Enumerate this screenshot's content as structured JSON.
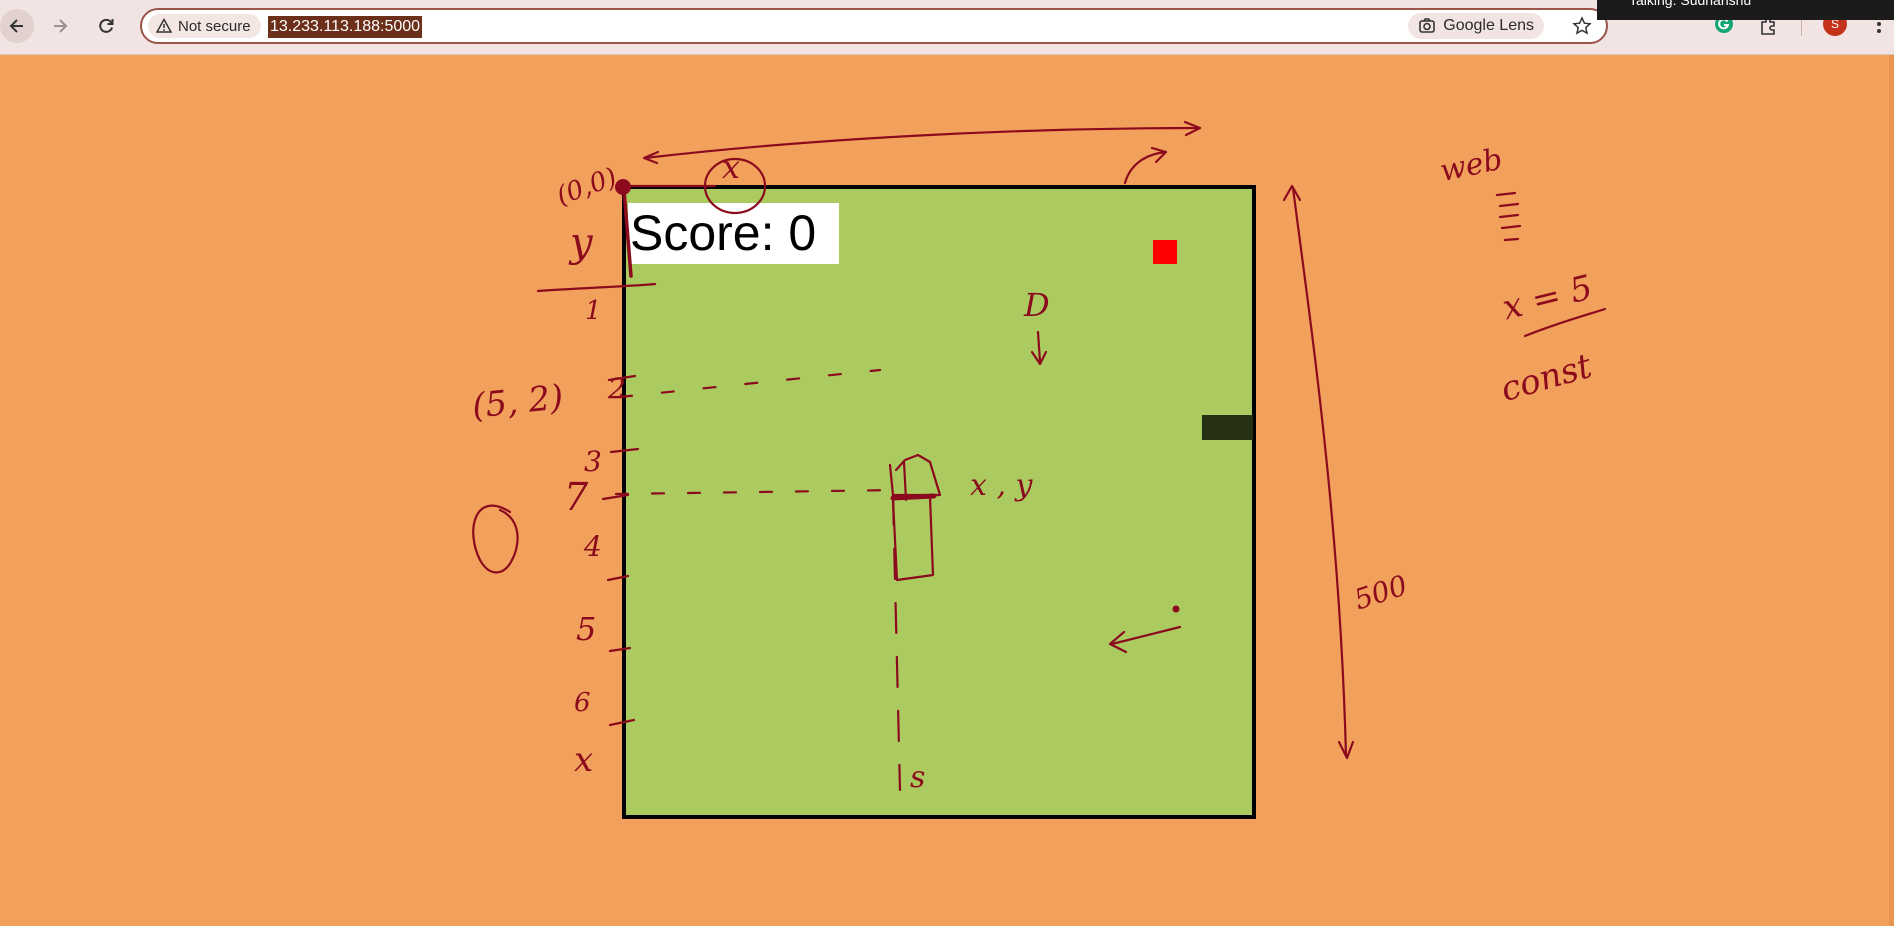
{
  "browser": {
    "security_label": "Not secure",
    "url": "13.233.113.188:5000",
    "lens_label": "Google Lens",
    "profile_initial": "S",
    "talking_banner": "Talking: Sudhanshu"
  },
  "game": {
    "score_text": "Score: 0"
  },
  "annotations": {
    "origin": "(0,0)",
    "x_label": "x",
    "y_label": "y",
    "y_ticks": [
      "1",
      "2",
      "3",
      "4",
      "5",
      "6",
      "7"
    ],
    "point_label": "(5, 2)",
    "point_xy": "x , y",
    "d_label": "D",
    "size_label": "500",
    "web_label": "web",
    "eq_label": "x = 5",
    "const_label": "const",
    "s_label": "s"
  },
  "colors": {
    "page_bg": "#f2a15c",
    "board": "#abcb60",
    "food": "#ff0000",
    "snake": "#263014",
    "ink": "#8b0a1e"
  }
}
